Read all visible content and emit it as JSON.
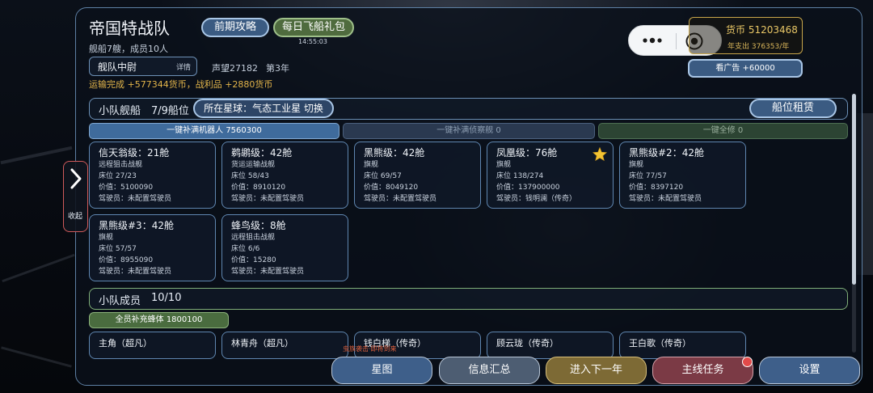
{
  "header": {
    "title": "帝国特战队",
    "fleet_stats": "舰船7艘，成员10人",
    "strategy_button": "前期攻略",
    "daily_gift_button": "每日飞船礼包",
    "timer": "14:55:03",
    "rank": "舰队中尉",
    "rank_detail": "详情",
    "reputation": "声望27182",
    "year": "第3年",
    "transport_notice": "运输完成 +577344货币，战利品 +2880货币"
  },
  "currency": {
    "label": "货币 51203468",
    "annual_expense": "年支出 376353/年",
    "watch_ad_button": "看广告 +60000"
  },
  "side_tab": {
    "label": "收起"
  },
  "ships_section": {
    "title": "小队舰船",
    "slots": "7/9船位",
    "planet": "所在星球：气态工业星 切换",
    "rent_button": "船位租赁",
    "refill_robots": "一键补满机器人 7560300",
    "refill_scouts": "一键补满侦察舰 0",
    "repair_all": "一键全修 0",
    "cards": [
      {
        "name": "信天翁级：21舱",
        "type": "远程狙击战舰",
        "beds": "床位 27/23",
        "value": "价值：5100090",
        "pilot": "驾驶员：未配置驾驶员",
        "starred": false
      },
      {
        "name": "鹈鹕级：42舱",
        "type": "货运运输战舰",
        "beds": "床位 58/43",
        "value": "价值：8910120",
        "pilot": "驾驶员：未配置驾驶员",
        "starred": false
      },
      {
        "name": "黑熊级：42舱",
        "type": "旗舰",
        "beds": "床位 69/57",
        "value": "价值：8049120",
        "pilot": "驾驶员：未配置驾驶员",
        "starred": false
      },
      {
        "name": "凤凰级：76舱",
        "type": "旗舰",
        "beds": "床位 138/274",
        "value": "价值：137900000",
        "pilot": "驾驶员：钱明澜（传奇）",
        "starred": true
      },
      {
        "name": "黑熊级#2：42舱",
        "type": "旗舰",
        "beds": "床位 77/57",
        "value": "价值：8397120",
        "pilot": "驾驶员：未配置驾驶员",
        "starred": false
      },
      {
        "name": "黑熊级#3：42舱",
        "type": "旗舰",
        "beds": "床位 57/57",
        "value": "价值：8955090",
        "pilot": "驾驶员：未配置驾驶员",
        "starred": false
      },
      {
        "name": "蜂鸟级：8舱",
        "type": "远程狙击战舰",
        "beds": "床位 6/6",
        "value": "价值：15280",
        "pilot": "驾驶员：未配置驾驶员",
        "starred": false
      }
    ]
  },
  "members_section": {
    "title": "小队成员",
    "count": "10/10",
    "replenish_button": "全员补充蜂体 1800100",
    "members": [
      {
        "name": "主角（超凡）"
      },
      {
        "name": "林青舟（超凡）"
      },
      {
        "name": "钱白梯（传奇）"
      },
      {
        "name": "顾云珑（传奇）"
      },
      {
        "name": "王白歌（传奇）"
      }
    ],
    "overlay_notice": "虫族袭击·即将到来"
  },
  "bottom_nav": {
    "star_map": "星图",
    "info_summary": "信息汇总",
    "next_year": "进入下一年",
    "main_quest": "主线任务",
    "settings": "设置"
  },
  "colors": {
    "accent_gold": "#e2b44a",
    "panel_border": "#5d7fa3",
    "side_tab_border": "#d05a5a",
    "notification_dot": "#e24a4a"
  }
}
